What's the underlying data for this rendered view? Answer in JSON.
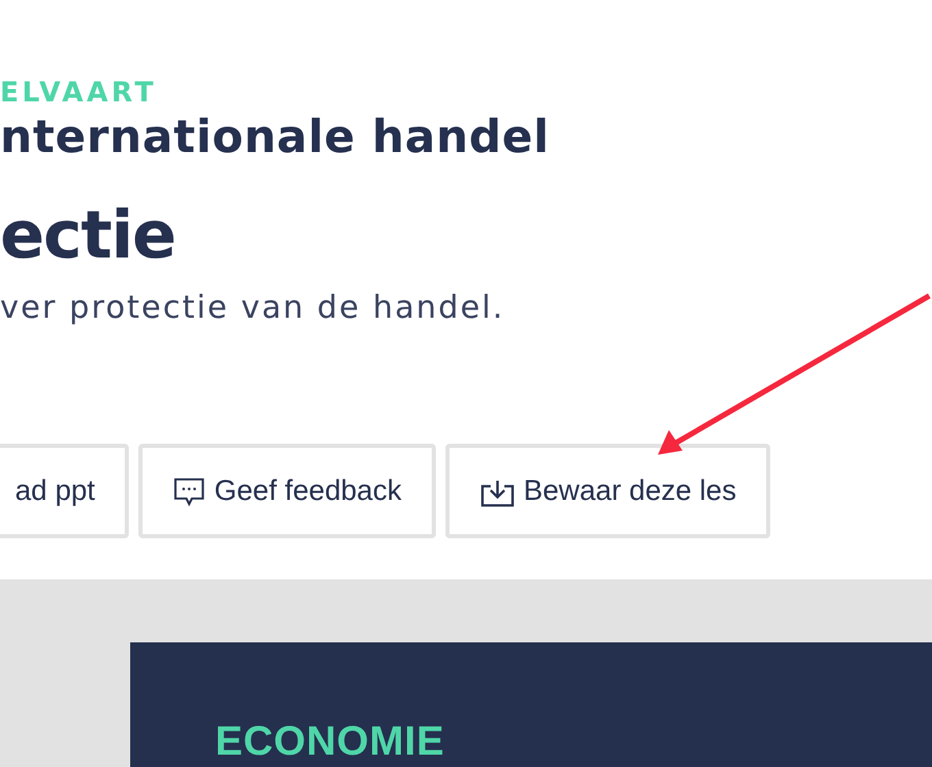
{
  "lesson": {
    "category": "ELVAART",
    "subtitle": "nternationale handel",
    "title": "ectie",
    "description": "ver protectie van de handel."
  },
  "buttons": [
    {
      "label": "ad ppt",
      "kind": "plain"
    },
    {
      "label": "Geef feedback",
      "kind": "feedback"
    },
    {
      "label": "Bewaar deze les",
      "kind": "save"
    }
  ],
  "slide": {
    "heading": "ECONOMIE"
  }
}
